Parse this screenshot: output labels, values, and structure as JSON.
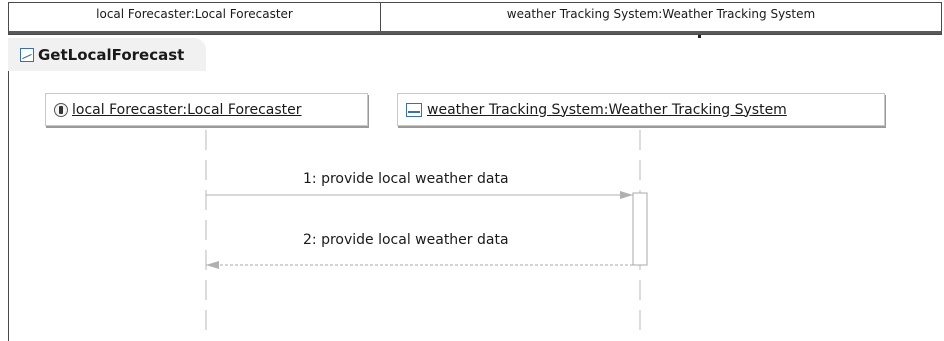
{
  "header": {
    "columns": [
      "local Forecaster:Local Forecaster",
      "weather Tracking System:Weather Tracking System"
    ]
  },
  "interaction": {
    "title": "GetLocalForecast",
    "icon": "interaction-icon"
  },
  "lifelines": [
    {
      "label": "local Forecaster:Local Forecaster",
      "icon": "class-icon"
    },
    {
      "label": "weather Tracking System:Weather Tracking System",
      "icon": "component-icon"
    }
  ],
  "messages": [
    {
      "label": "1: provide local weather data",
      "kind": "synchronous call",
      "from": "local Forecaster",
      "to": "weather Tracking System"
    },
    {
      "label": "2: provide local weather data",
      "kind": "reply",
      "from": "weather Tracking System",
      "to": "local Forecaster"
    }
  ],
  "colors": {
    "line": "#b8b8b8",
    "frame": "#4a4a4a",
    "icon_blue": "#3a6fb0"
  }
}
